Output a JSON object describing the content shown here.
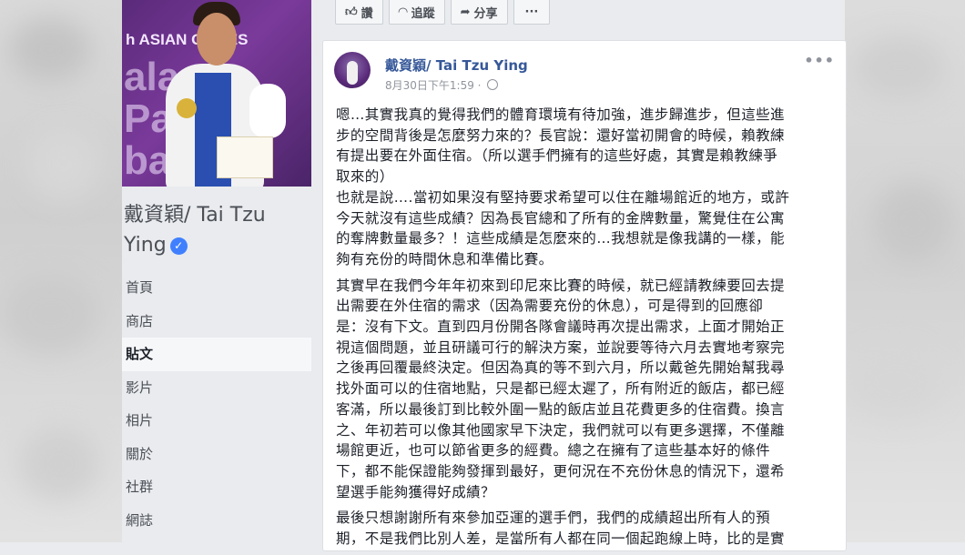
{
  "actions": {
    "like": "讚",
    "follow": "追蹤",
    "share": "分享",
    "more": "···"
  },
  "sidebar": {
    "page_name": "戴資穎/ Tai Tzu Ying",
    "photo_texts": [
      "h ASIAN GAMES",
      "ala",
      "Pa",
      "ba"
    ],
    "nav": [
      {
        "label": "首頁",
        "active": false
      },
      {
        "label": "商店",
        "active": false
      },
      {
        "label": "貼文",
        "active": true
      },
      {
        "label": "影片",
        "active": false
      },
      {
        "label": "相片",
        "active": false
      },
      {
        "label": "關於",
        "active": false
      },
      {
        "label": "社群",
        "active": false
      },
      {
        "label": "網誌",
        "active": false
      }
    ]
  },
  "post": {
    "author": "戴資穎/ Tai Tzu Ying",
    "timestamp": "8月30日下午1:59 ·",
    "options": "•••",
    "paragraphs": [
      "嗯…其實我真的覺得我們的體育環境有待加強，進步歸進步，但這些進\n步的空間背後是怎麼努力來的？長官說：還好當初開會的時候，賴教練\n有提出要在外面住宿。（所以選手們擁有的這些好處，其實是賴教練爭\n取來的）\n也就是說….當初如果沒有堅持要求希望可以住在離場館近的地方，或許\n今天就沒有這些成績？因為長官總和了所有的金牌數量，驚覺住在公寓\n的奪牌數量最多？！這些成績是怎麼來的…我想就是像我講的一樣，能\n夠有充份的時間休息和準備比賽。",
      "其實早在我們今年年初來到印尼來比賽的時候，就已經請教練要回去提\n出需要在外住宿的需求（因為需要充份的休息），可是得到的回應卻\n是：沒有下文。直到四月份開各隊會議時再次提出需求，上面才開始正\n視這個問題，並且研議可行的解決方案，並說要等待六月去實地考察完\n之後再回覆最終決定。但因為真的等不到六月，所以戴爸先開始幫我尋\n找外面可以的住宿地點，只是都已經太遲了，所有附近的飯店，都已經\n客滿，所以最後訂到比較外圍一點的飯店並且花費更多的住宿費。換言\n之、年初若可以像其他國家早下決定，我們就可以有更多選擇，不僅離\n場館更近，也可以節省更多的經費。總之在擁有了這些基本好的條件\n下，都不能保證能夠發揮到最好，更何況在不充份休息的情況下，還希\n望選手能夠獲得好成績？",
      "最後只想謝謝所有來參加亞運的選手們，我們的成績超出所有人的預\n期，不是我們比別人差，是當所有人都在同一個起跑線上時，比的是實"
    ]
  },
  "colors": {
    "link": "#365899",
    "page_bg": "#e9ebee",
    "verified": "#4080ff"
  }
}
